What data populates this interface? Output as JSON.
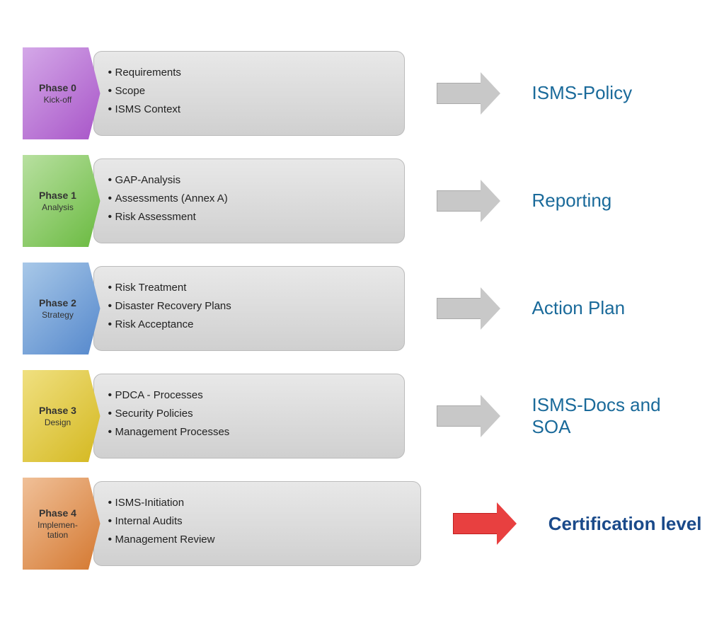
{
  "phases": [
    {
      "id": "phase-0",
      "title": "Phase 0",
      "subtitle": "Kick-off",
      "colorClass": "phase-0",
      "items": [
        "Requirements",
        "Scope",
        "ISMS Context"
      ],
      "arrowClass": "gray-arrow",
      "output": "ISMS-Policy",
      "outputClass": "output-label"
    },
    {
      "id": "phase-1",
      "title": "Phase 1",
      "subtitle": "Analysis",
      "colorClass": "phase-1",
      "items": [
        "GAP-Analysis",
        "Assessments (Annex A)",
        "Risk Assessment"
      ],
      "arrowClass": "gray-arrow",
      "output": "Reporting",
      "outputClass": "output-label"
    },
    {
      "id": "phase-2",
      "title": "Phase 2",
      "subtitle": "Strategy",
      "colorClass": "phase-2",
      "items": [
        "Risk Treatment",
        "Disaster Recovery Plans",
        "Risk Acceptance"
      ],
      "arrowClass": "gray-arrow",
      "output": "Action Plan",
      "outputClass": "output-label"
    },
    {
      "id": "phase-3",
      "title": "Phase 3",
      "subtitle": "Design",
      "colorClass": "phase-3",
      "items": [
        "PDCA - Processes",
        "Security Policies",
        "Management Processes"
      ],
      "arrowClass": "gray-arrow",
      "output": "ISMS-Docs and SOA",
      "outputClass": "output-label"
    },
    {
      "id": "phase-4",
      "title": "Phase 4",
      "subtitle": "Implemen-\ntation",
      "colorClass": "phase-4",
      "items": [
        "ISMS-Initiation",
        "Internal Audits",
        "Management Review"
      ],
      "arrowClass": "red-arrow",
      "output": "Certification level",
      "outputClass": "cert-label"
    }
  ]
}
